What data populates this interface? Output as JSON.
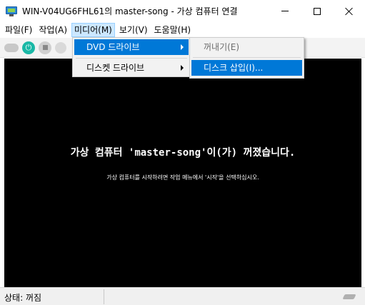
{
  "window": {
    "title": "WIN-V04UG6FHL61의 master-song - 가상 컴퓨터 연결"
  },
  "menubar": {
    "items": [
      "파일(F)",
      "작업(A)",
      "미디어(M)",
      "보기(V)",
      "도움말(H)"
    ],
    "active": "미디어(M)"
  },
  "media_menu": {
    "items": [
      {
        "label": "DVD 드라이브",
        "highlighted": true,
        "submenu": true
      },
      {
        "label": "디스켓 드라이브",
        "highlighted": false,
        "submenu": true
      }
    ]
  },
  "dvd_menu": {
    "items": [
      {
        "label": "꺼내기(E)",
        "enabled": false
      },
      {
        "label": "디스크 삽입(I)...",
        "enabled": true,
        "highlighted": true
      }
    ]
  },
  "toolbar": {
    "icons": [
      "ctrl-alt-del-icon",
      "power-icon",
      "stop-icon",
      "reset-icon"
    ]
  },
  "screen": {
    "message": "가상 컴퓨터 'master-song'이(가) 꺼졌습니다.",
    "hint": "가상 컴퓨터를 시작하려면 작업 메뉴에서 '시작'을 선택하십시오."
  },
  "status": {
    "text": "상태: 꺼짐"
  },
  "colors": {
    "highlight": "#0078d7",
    "menu_active": "#cce8ff",
    "screen": "#000000"
  }
}
